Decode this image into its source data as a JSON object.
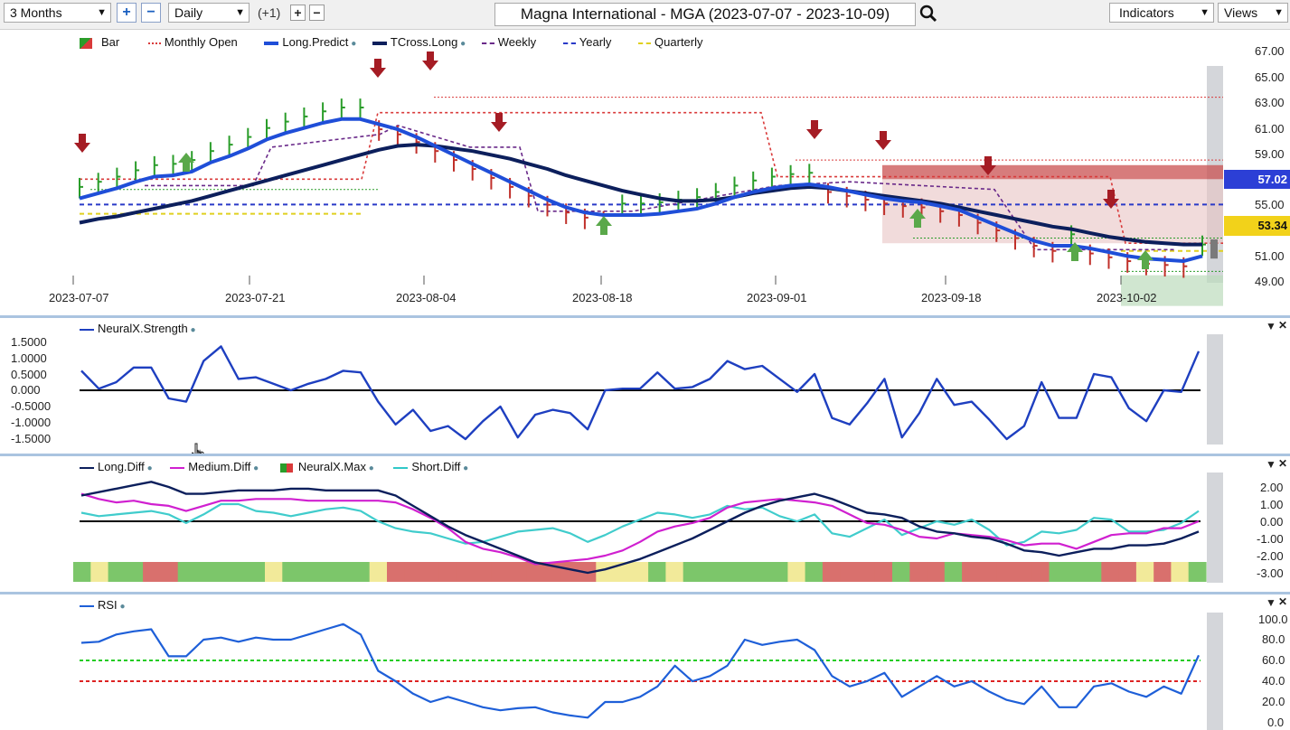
{
  "toolbar": {
    "period": "3 Months",
    "interval": "Daily",
    "step": "(+1)",
    "title": "Magna International - MGA (2023-07-07 - 2023-10-09)",
    "indicators": "Indicators",
    "views": "Views",
    "plus": "+",
    "minus": "−"
  },
  "price_pane": {
    "legend": [
      {
        "label": "Bar",
        "color": "#2a9d2a"
      },
      {
        "label": "Monthly Open",
        "color": "#d93a3a"
      },
      {
        "label": "Long.Predict",
        "color": "#1f4ed8"
      },
      {
        "label": "TCross.Long",
        "color": "#0c1f5c"
      },
      {
        "label": "Weekly",
        "color": "#6a2a8a"
      },
      {
        "label": "Yearly",
        "color": "#2a3ac8"
      },
      {
        "label": "Quarterly",
        "color": "#e0d020"
      }
    ],
    "y_ticks": [
      "67.00",
      "65.00",
      "63.00",
      "61.00",
      "59.00",
      "57.00",
      "55.00",
      "53.00",
      "51.00",
      "49.00"
    ],
    "x_ticks": [
      "2023-07-07",
      "2023-07-21",
      "2023-08-04",
      "2023-08-18",
      "2023-09-01",
      "2023-09-18",
      "2023-10-02"
    ],
    "badge_yearly": "57.02",
    "badge_last": "53.34",
    "colors": {
      "yearly_badge": "#2c3fd6",
      "last_badge": "#f2d21a"
    }
  },
  "neural_pane": {
    "legend": [
      {
        "label": "NeuralX.Strength",
        "color": "#1e3fc0"
      }
    ],
    "y_ticks": [
      "1.5000",
      "1.0000",
      "0.5000",
      "0.000",
      "-0.5000",
      "-1.0000",
      "-1.5000"
    ]
  },
  "diff_pane": {
    "legend": [
      {
        "label": "Long.Diff",
        "color": "#0c1f5c"
      },
      {
        "label": "Medium.Diff",
        "color": "#d020d0"
      },
      {
        "label": "NeuralX.Max",
        "color": "#2a9d2a"
      },
      {
        "label": "Short.Diff",
        "color": "#30c8c8"
      }
    ],
    "y_ticks": [
      "2.00",
      "1.00",
      "0.00",
      "-1.00",
      "-2.00",
      "-3.00"
    ]
  },
  "rsi_pane": {
    "legend": [
      {
        "label": "RSI",
        "color": "#1e5fd8"
      }
    ],
    "y_ticks": [
      "100.0",
      "80.0",
      "60.0",
      "40.0",
      "20.0",
      "0.0"
    ]
  },
  "pane_controls": {
    "collapse": "▼",
    "close": "✕"
  },
  "chart_data": [
    {
      "type": "line",
      "title": "Magna International - MGA (2023-07-07 - 2023-10-09)",
      "ylim": [
        49,
        67
      ],
      "series": [
        {
          "name": "Long.Predict",
          "values": [
            57.5,
            57.9,
            58.3,
            58.8,
            59.2,
            59.3,
            59.6,
            60.3,
            60.8,
            61.4,
            62.1,
            62.6,
            63.0,
            63.4,
            63.7,
            63.7,
            63.3,
            62.9,
            62.3,
            61.6,
            60.9,
            60.2,
            59.5,
            58.8,
            58.1,
            57.4,
            56.8,
            56.4,
            56.2,
            56.2,
            56.2,
            56.3,
            56.5,
            56.7,
            57.1,
            57.6,
            58.0,
            58.3,
            58.5,
            58.6,
            58.4,
            58.1,
            57.8,
            57.5,
            57.3,
            57.2,
            56.9,
            56.6,
            56.0,
            55.4,
            54.8,
            54.2,
            53.8,
            53.8,
            53.6,
            53.3,
            53.0,
            52.8,
            52.7,
            52.6,
            53.0
          ]
        },
        {
          "name": "TCross.Long",
          "values": [
            55.6,
            55.9,
            56.1,
            56.4,
            56.7,
            57.0,
            57.3,
            57.7,
            58.1,
            58.5,
            58.9,
            59.3,
            59.7,
            60.1,
            60.5,
            60.9,
            61.3,
            61.6,
            61.7,
            61.6,
            61.4,
            61.2,
            60.9,
            60.6,
            60.2,
            59.8,
            59.3,
            58.9,
            58.5,
            58.1,
            57.8,
            57.5,
            57.3,
            57.3,
            57.4,
            57.6,
            57.9,
            58.1,
            58.3,
            58.4,
            58.3,
            58.1,
            57.9,
            57.7,
            57.5,
            57.3,
            57.1,
            56.8,
            56.5,
            56.2,
            55.9,
            55.6,
            55.3,
            55.1,
            54.8,
            54.5,
            54.3,
            54.1,
            54.0,
            53.9,
            53.9
          ]
        }
      ]
    },
    {
      "type": "line",
      "ylim": [
        -1.6,
        1.6
      ],
      "series": [
        {
          "name": "NeuralX.Strength",
          "values": [
            0.6,
            0.05,
            0.25,
            0.7,
            0.7,
            -0.25,
            -0.35,
            0.9,
            1.35,
            0.35,
            0.4,
            0.2,
            0.0,
            0.2,
            0.35,
            0.6,
            0.55,
            -0.35,
            -1.05,
            -0.6,
            -1.25,
            -1.1,
            -1.5,
            -0.95,
            -0.5,
            -1.45,
            -0.75,
            -0.6,
            -0.7,
            -1.2,
            0.0,
            0.05,
            0.05,
            0.55,
            0.05,
            0.1,
            0.35,
            0.9,
            0.65,
            0.75,
            0.35,
            -0.05,
            0.5,
            -0.85,
            -1.05,
            -0.4,
            0.35,
            -1.45,
            -0.7,
            0.35,
            -0.45,
            -0.35,
            -0.9,
            -1.5,
            -1.1,
            0.25,
            -0.85,
            -0.85,
            0.5,
            0.4,
            -0.55,
            -0.95,
            0.0,
            -0.05,
            1.2
          ]
        }
      ]
    },
    {
      "type": "line",
      "ylim": [
        -3.5,
        2.7
      ],
      "series": [
        {
          "name": "Long.Diff",
          "values": [
            1.5,
            1.7,
            1.9,
            2.1,
            2.3,
            2.0,
            1.6,
            1.6,
            1.7,
            1.8,
            1.8,
            1.8,
            1.9,
            1.9,
            1.8,
            1.8,
            1.8,
            1.8,
            1.5,
            0.9,
            0.3,
            -0.3,
            -0.8,
            -1.2,
            -1.6,
            -2.0,
            -2.4,
            -2.6,
            -2.8,
            -3.0,
            -2.8,
            -2.5,
            -2.2,
            -1.8,
            -1.4,
            -1.0,
            -0.5,
            0.0,
            0.5,
            0.9,
            1.2,
            1.4,
            1.6,
            1.3,
            0.9,
            0.5,
            0.4,
            0.2,
            -0.3,
            -0.6,
            -0.7,
            -0.9,
            -1.0,
            -1.3,
            -1.7,
            -1.8,
            -2.0,
            -1.8,
            -1.6,
            -1.6,
            -1.4,
            -1.4,
            -1.3,
            -1.0,
            -0.6
          ]
        },
        {
          "name": "Medium.Diff",
          "values": [
            1.6,
            1.3,
            1.1,
            1.2,
            1.0,
            0.9,
            0.6,
            0.9,
            1.2,
            1.2,
            1.3,
            1.3,
            1.3,
            1.2,
            1.2,
            1.2,
            1.2,
            1.2,
            1.1,
            0.7,
            0.2,
            -0.4,
            -1.2,
            -1.6,
            -1.8,
            -2.1,
            -2.5,
            -2.4,
            -2.3,
            -2.2,
            -2.0,
            -1.7,
            -1.2,
            -0.6,
            -0.3,
            -0.1,
            0.2,
            0.8,
            1.1,
            1.2,
            1.3,
            1.2,
            1.1,
            0.9,
            0.4,
            -0.1,
            -0.2,
            -0.5,
            -0.9,
            -1.0,
            -0.7,
            -0.8,
            -0.9,
            -1.1,
            -1.4,
            -1.3,
            -1.3,
            -1.6,
            -1.2,
            -0.8,
            -0.7,
            -0.7,
            -0.4,
            -0.4,
            0.0
          ]
        },
        {
          "name": "Short.Diff",
          "values": [
            0.5,
            0.3,
            0.4,
            0.5,
            0.6,
            0.4,
            -0.1,
            0.4,
            1.0,
            1.0,
            0.6,
            0.5,
            0.3,
            0.5,
            0.7,
            0.8,
            0.6,
            0.0,
            -0.4,
            -0.6,
            -0.7,
            -1.0,
            -1.3,
            -1.2,
            -0.9,
            -0.6,
            -0.5,
            -0.4,
            -0.7,
            -1.2,
            -0.8,
            -0.3,
            0.1,
            0.5,
            0.4,
            0.2,
            0.4,
            0.9,
            0.7,
            0.8,
            0.3,
            0.0,
            0.4,
            -0.7,
            -0.9,
            -0.4,
            0.1,
            -0.8,
            -0.4,
            0.0,
            -0.2,
            0.1,
            -0.5,
            -1.4,
            -1.2,
            -0.6,
            -0.7,
            -0.5,
            0.2,
            0.1,
            -0.6,
            -0.6,
            -0.5,
            -0.1,
            0.6
          ]
        }
      ],
      "neuralx_max_states": [
        "g",
        "y",
        "g",
        "g",
        "r",
        "r",
        "g",
        "g",
        "g",
        "g",
        "g",
        "y",
        "g",
        "g",
        "g",
        "g",
        "g",
        "y",
        "r",
        "r",
        "r",
        "r",
        "r",
        "r",
        "r",
        "r",
        "r",
        "r",
        "r",
        "r",
        "y",
        "y",
        "y",
        "g",
        "y",
        "g",
        "g",
        "g",
        "g",
        "g",
        "g",
        "y",
        "g",
        "r",
        "r",
        "r",
        "r",
        "g",
        "r",
        "r",
        "g",
        "r",
        "r",
        "r",
        "r",
        "r",
        "g",
        "g",
        "g",
        "r",
        "r",
        "y",
        "r",
        "y",
        "g"
      ]
    },
    {
      "type": "line",
      "ylim": [
        0,
        100
      ],
      "series": [
        {
          "name": "RSI",
          "values": [
            77,
            78,
            85,
            88,
            90,
            64,
            64,
            80,
            82,
            78,
            82,
            80,
            80,
            85,
            90,
            95,
            85,
            50,
            40,
            28,
            20,
            25,
            20,
            15,
            12,
            14,
            15,
            10,
            7,
            5,
            20,
            20,
            25,
            35,
            55,
            40,
            45,
            55,
            80,
            75,
            78,
            80,
            70,
            45,
            35,
            40,
            48,
            25,
            35,
            45,
            35,
            40,
            30,
            22,
            18,
            35,
            15,
            15,
            35,
            38,
            30,
            25,
            35,
            28,
            65
          ]
        },
        {
          "name": "Overbought",
          "values": [
            60
          ]
        },
        {
          "name": "Oversold",
          "values": [
            40
          ]
        }
      ]
    }
  ]
}
